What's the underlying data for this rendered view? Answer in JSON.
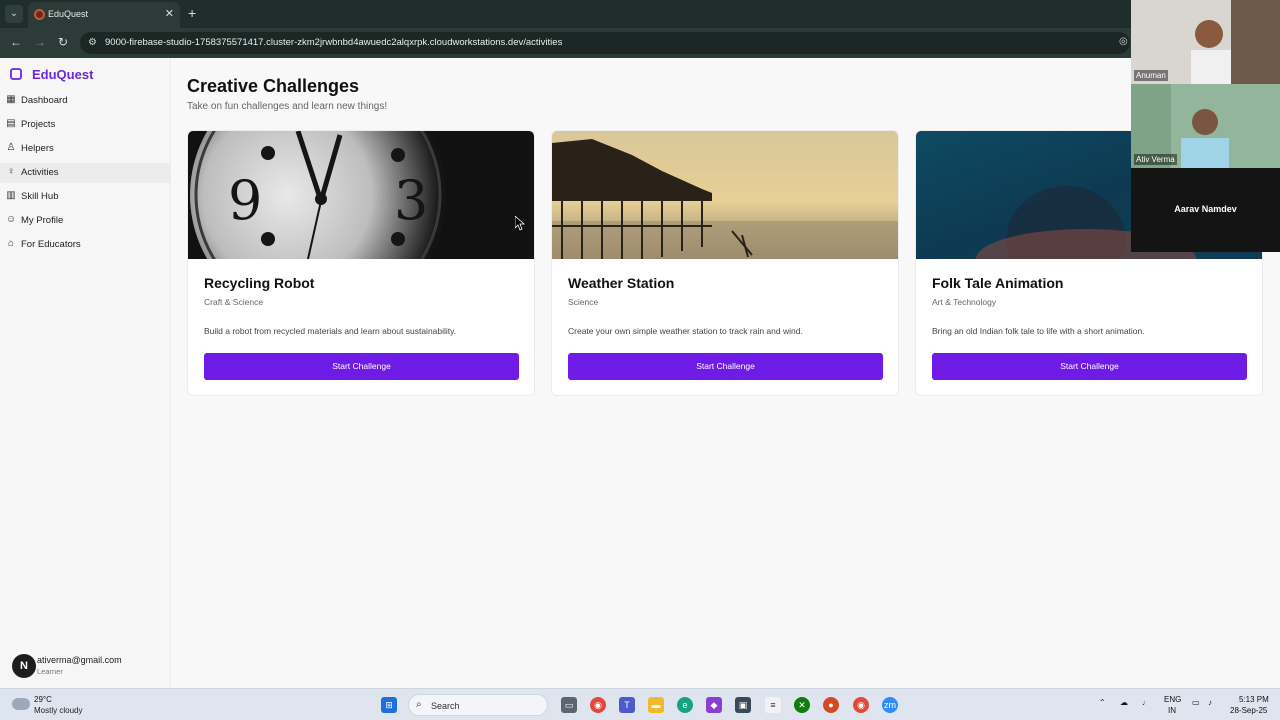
{
  "browser": {
    "tab_title": "EduQuest",
    "tab_close": "✕",
    "new_tab": "+",
    "url": "9000-firebase-studio-1758375571417.cluster-zkm2jrwbnbd4awuedc2alqxrpk.cloudworkstations.dev/activities"
  },
  "app": {
    "name": "EduQuest",
    "nav": [
      {
        "label": "Dashboard",
        "icon": "dashboard-grid-icon"
      },
      {
        "label": "Projects",
        "icon": "book-icon"
      },
      {
        "label": "Helpers",
        "icon": "users-icon"
      },
      {
        "label": "Activities",
        "icon": "lightbulb-icon"
      },
      {
        "label": "Skill Hub",
        "icon": "library-icon"
      },
      {
        "label": "My Profile",
        "icon": "user-icon"
      },
      {
        "label": "For Educators",
        "icon": "school-icon"
      }
    ],
    "active_nav": "Activities",
    "user": {
      "avatar_initial": "N",
      "email": "ativerma@gmail.com",
      "role": "Learner"
    }
  },
  "page": {
    "title": "Creative Challenges",
    "subtitle": "Take on fun challenges and learn new things!"
  },
  "cards": [
    {
      "title": "Recycling Robot",
      "category": "Craft & Science",
      "description": "Build a robot from recycled materials and learn about sustainability.",
      "button": "Start Challenge",
      "image": "clock-photo"
    },
    {
      "title": "Weather Station",
      "category": "Science",
      "description": "Create your own simple weather station to track rain and wind.",
      "button": "Start Challenge",
      "image": "pier-sunset-photo"
    },
    {
      "title": "Folk Tale Animation",
      "category": "Art & Technology",
      "description": "Bring an old Indian folk tale to life with a short animation.",
      "button": "Start Challenge",
      "image": "underwater-photo"
    }
  ],
  "video_call": {
    "participants": [
      "Anuman",
      "Ativ Verma",
      "Aarav Namdev"
    ]
  },
  "taskbar": {
    "weather_temp": "29°C",
    "weather_desc": "Mostly cloudy",
    "search_label": "Search",
    "lang_top": "ENG",
    "lang_bottom": "IN",
    "time": "5:13 PM",
    "date": "28-Sep-25"
  },
  "colors": {
    "brand": "#6d28d9",
    "button": "#6d1be5",
    "browser_chrome": "#2c3b37"
  }
}
